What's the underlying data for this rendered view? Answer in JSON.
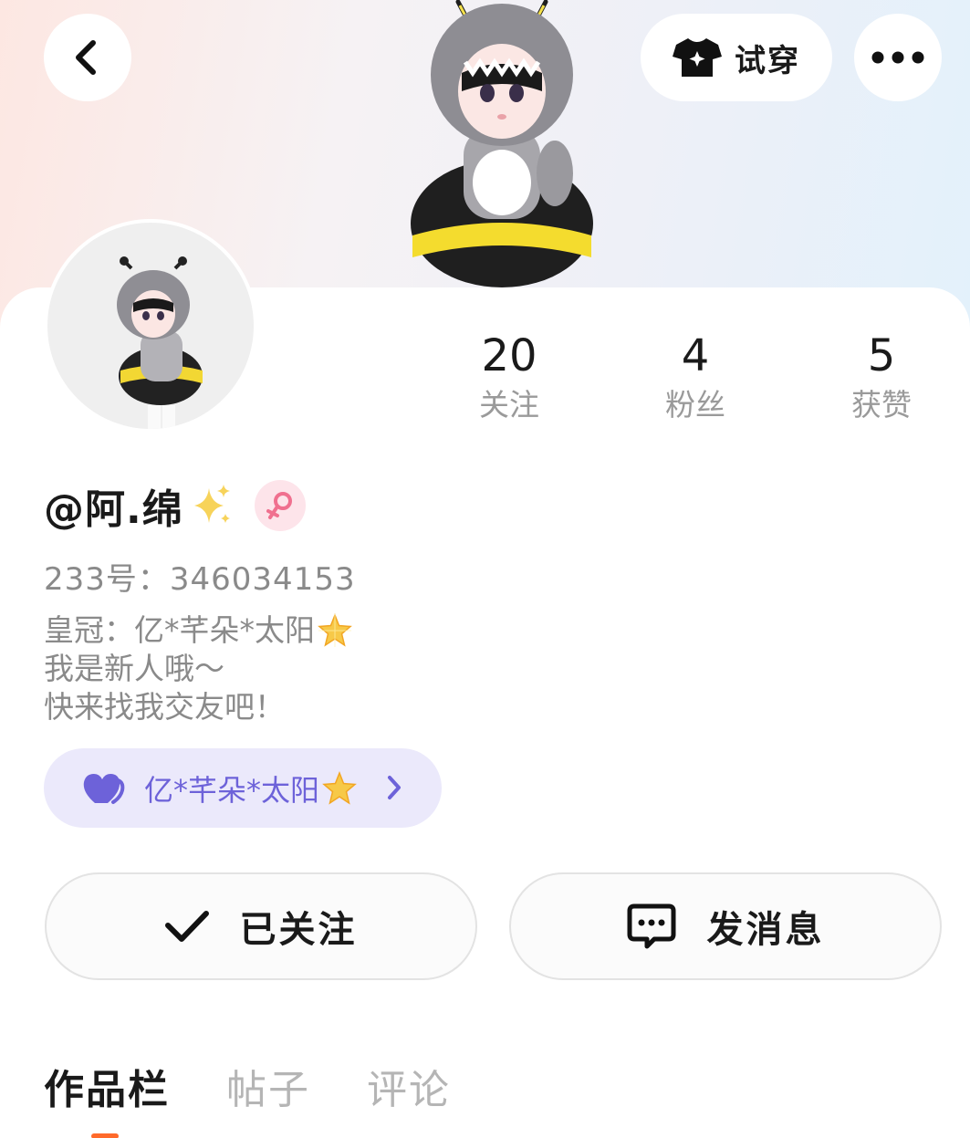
{
  "header": {
    "tryon_label": "试穿"
  },
  "stats": [
    {
      "value": "20",
      "label": "关注"
    },
    {
      "value": "4",
      "label": "粉丝"
    },
    {
      "value": "5",
      "label": "获赞"
    }
  ],
  "profile": {
    "username": "@阿.绵",
    "user_id": "233号：346034153",
    "bio_lines": [
      "皇冠：亿*芊朵*太阳",
      "我是新人哦～",
      "快来找我交友吧！"
    ],
    "crown_tag": "亿*芊朵*太阳"
  },
  "actions": {
    "follow_label": "已关注",
    "message_label": "发消息"
  },
  "tabs": [
    {
      "label": "作品栏",
      "active": true
    },
    {
      "label": "帖子",
      "active": false
    },
    {
      "label": "评论",
      "active": false
    }
  ],
  "colors": {
    "accent_purple": "#6d62d9",
    "tag_background": "#ebe9fb",
    "gender_pink": "#f0708f",
    "tab_indicator": "#ff6a2b"
  },
  "icons": [
    "back-arrow-icon",
    "tshirt-icon",
    "more-dots-icon",
    "sparkle-icon",
    "female-icon",
    "star-icon",
    "heart-icon",
    "chevron-right-icon",
    "check-icon",
    "chat-bubble-icon"
  ]
}
